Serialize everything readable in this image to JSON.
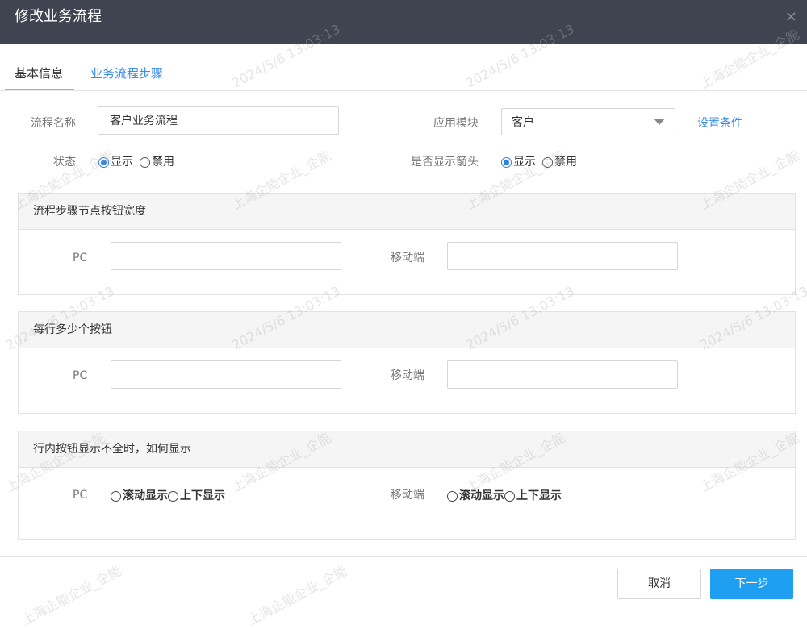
{
  "dialog": {
    "title": "修改业务流程",
    "close_label": "×"
  },
  "tabs": [
    {
      "label": "基本信息"
    },
    {
      "label": "业务流程步骤"
    }
  ],
  "form": {
    "name_label": "流程名称",
    "name_value": "客户业务流程",
    "module_label": "应用模块",
    "module_value": "客户",
    "set_condition_link": "设置条件",
    "status_label": "状态",
    "status_options": [
      {
        "label": "显示",
        "checked": true
      },
      {
        "label": "禁用",
        "checked": false
      }
    ],
    "arrow_label": "是否显示箭头",
    "arrow_options": [
      {
        "label": "显示",
        "checked": true
      },
      {
        "label": "禁用",
        "checked": false
      }
    ]
  },
  "panels": [
    {
      "title": "流程步骤节点按钮宽度",
      "pc_label": "PC",
      "pc_value": "",
      "mobile_label": "移动端",
      "mobile_value": ""
    },
    {
      "title": "每行多少个按钮",
      "pc_label": "PC",
      "pc_value": "",
      "mobile_label": "移动端",
      "mobile_value": ""
    },
    {
      "title": "行内按钮显示不全时，如何显示",
      "pc_label": "PC",
      "mobile_label": "移动端",
      "pc_options": [
        {
          "label": "滚动显示"
        },
        {
          "label": "上下显示"
        }
      ],
      "mobile_options": [
        {
          "label": "滚动显示"
        },
        {
          "label": "上下显示"
        }
      ]
    }
  ],
  "footer": {
    "cancel_label": "取消",
    "next_label": "下一步"
  },
  "watermark": {
    "company": "上海企能企业_企能",
    "timestamp": "2024/5/6 13:03:13"
  },
  "colors": {
    "header_bg": "#3f4450",
    "accent": "#1e9ff2",
    "link": "#3a8ee6",
    "tab_underline": "#f4a15a"
  }
}
